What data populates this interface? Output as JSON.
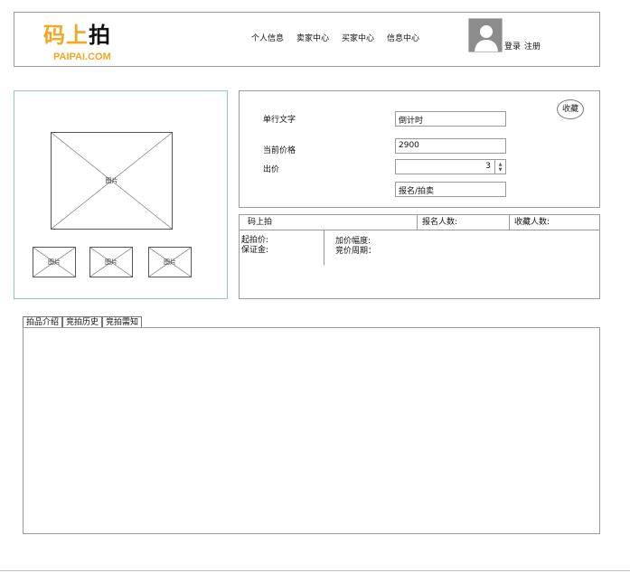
{
  "header": {
    "logo": {
      "text_orange": "码上",
      "text_black": "拍",
      "subtitle": "PAIPAI.COM",
      "color_orange": "#f5a623"
    },
    "nav": [
      {
        "label": "个人信息"
      },
      {
        "label": "卖家中心"
      },
      {
        "label": "买家中心"
      },
      {
        "label": "信息中心"
      }
    ],
    "avatar_icon": "user-avatar-icon",
    "login_label": "登录",
    "register_label": "注册"
  },
  "gallery": {
    "main_image_label": "图片",
    "thumbnails": [
      {
        "label": "图片"
      },
      {
        "label": "图片"
      },
      {
        "label": "图片"
      }
    ]
  },
  "info": {
    "title_label": "单行文字",
    "countdown_value": "倒计时",
    "price_label": "当前价格",
    "price_value": "2900",
    "bid_label": "出价",
    "bid_value": "3",
    "signup_button": "报名/拍卖",
    "favorite_button": "收藏"
  },
  "stats": {
    "seller": "码上拍",
    "signup_count_label": "报名人数:",
    "favorite_count_label": "收藏人数:",
    "start_price_label": "起拍价:",
    "deposit_label": "保证金:",
    "increment_label": "加价幅度:",
    "cycle_label": "竞价周期："
  },
  "tabs": [
    {
      "label": "拍品介绍"
    },
    {
      "label": "竞拍历史"
    },
    {
      "label": "竞拍需知"
    }
  ]
}
